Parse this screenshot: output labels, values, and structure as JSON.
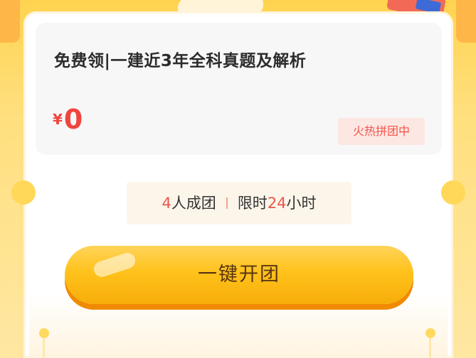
{
  "product": {
    "title": "免费领|一建近3年全科真题及解析",
    "price_symbol": "¥",
    "price_value": "0",
    "status_badge": "火热拼团中"
  },
  "group_info": {
    "people_count": "4",
    "people_suffix": "人成团",
    "time_prefix": "限时",
    "time_hours": "24",
    "time_suffix": "小时"
  },
  "cta": {
    "label": "一键开团"
  },
  "colors": {
    "accent_red": "#f0453e",
    "button_yellow": "#ffc21b",
    "background_yellow": "#ffd34f"
  }
}
